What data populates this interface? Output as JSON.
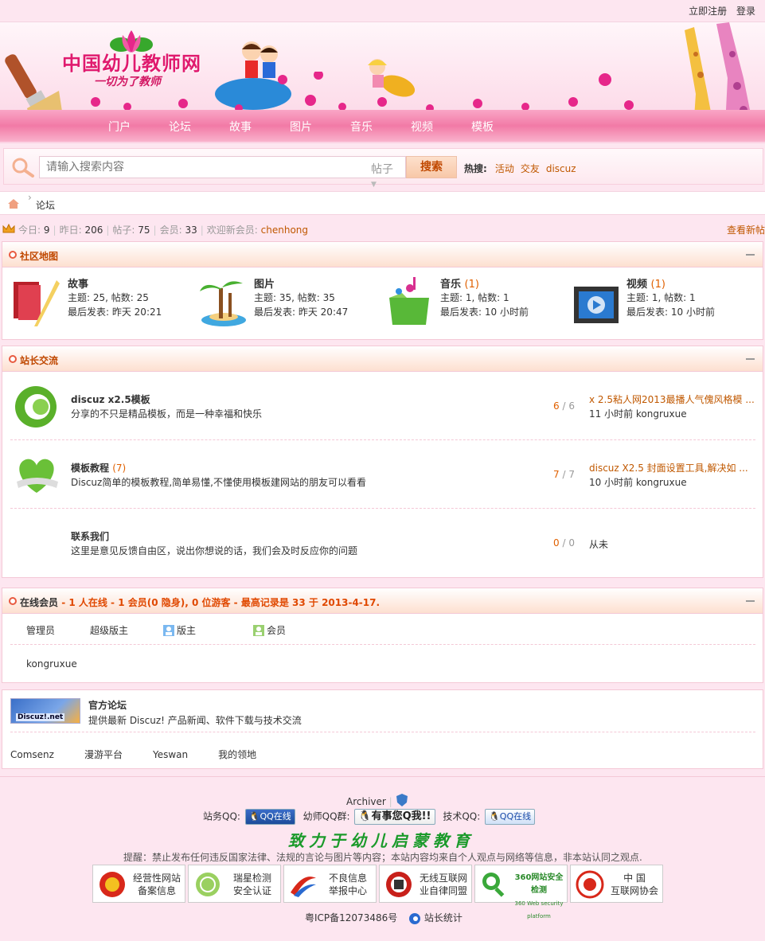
{
  "top": {
    "register": "立即注册",
    "login": "登录"
  },
  "brand": {
    "name": "中国幼儿教师网",
    "slogan": "一切为了教师"
  },
  "nav": [
    "门户",
    "论坛",
    "故事",
    "图片",
    "音乐",
    "视频",
    "模板"
  ],
  "search": {
    "placeholder": "请输入搜索内容",
    "type": "帖子",
    "button": "搜索",
    "hot_label": "热搜:",
    "hot": [
      "活动",
      "交友",
      "discuz"
    ]
  },
  "breadcrumb": {
    "current": "论坛"
  },
  "stats": {
    "today_label": "今日:",
    "today": "9",
    "yesterday_label": "昨日:",
    "yesterday": "206",
    "posts_label": "帖子:",
    "posts": "75",
    "members_label": "会员:",
    "members": "33",
    "welcome_label": "欢迎新会员:",
    "newest": "chenhong",
    "new_posts": "查看新帖"
  },
  "community": {
    "title": "社区地图",
    "cats": [
      {
        "name": "故事",
        "count": "",
        "l2": "主题: 25, 帖数: 25",
        "l3": "最后发表: 昨天 20:21",
        "icon": "book-quill-icon"
      },
      {
        "name": "图片",
        "count": "",
        "l2": "主题: 35, 帖数: 35",
        "l3": "最后发表: 昨天 20:47",
        "icon": "palm-island-icon"
      },
      {
        "name": "音乐",
        "count": "(1)",
        "l2": "主题: 1, 帖数: 1",
        "l3": "最后发表: 10 小时前",
        "icon": "music-folder-icon"
      },
      {
        "name": "视频",
        "count": "(1)",
        "l2": "主题: 1, 帖数: 1",
        "l3": "最后发表: 10 小时前",
        "icon": "film-strip-icon"
      }
    ]
  },
  "webmaster": {
    "title": "站长交流",
    "forums": [
      {
        "name": "discuz x2.5模板",
        "count": "",
        "desc": "分享的不只是精品模板，而是一种幸福和快乐",
        "threads": "6",
        "posts": "6",
        "last": "x 2.5粘人网2013最播人气傀风格模 ...",
        "meta": "11 小时前  kongruxue"
      },
      {
        "name": "模板教程",
        "count": "(7)",
        "desc": "Discuz简单的模板教程,简单易懂,不懂使用模板建网站的朋友可以看看",
        "threads": "7",
        "posts": "7",
        "last": "discuz X2.5 封面设置工具,解决如 ...",
        "meta": "10 小时前  kongruxue"
      },
      {
        "name": "联系我们",
        "count": "",
        "desc": "这里是意见反馈自由区，说出你想说的话，我们会及时反应你的问题",
        "threads": "0",
        "posts": "0",
        "never": "从未"
      }
    ]
  },
  "online": {
    "title": "在线会员",
    "summary": " - 1 人在线 - 1 会员(0 隐身), 0 位游客 - 最高记录是 33 于 2013-4-17.",
    "legend": [
      "管理员",
      "超级版主",
      "版主",
      "会员"
    ],
    "user": "kongruxue"
  },
  "links": {
    "logo_text": "Discuz!.net",
    "title": "官方论坛",
    "desc": "提供最新 Discuz! 产品新闻、软件下载与技术交流",
    "items": [
      "Comsenz",
      "漫游平台",
      "Yeswan",
      "我的领地"
    ]
  },
  "footer": {
    "archiver": "Archiver",
    "qq_site": "站务QQ:",
    "qq_btn": "QQ在线",
    "qq_group": "幼师QQ群:",
    "qq_msg": "有事您Q我!!",
    "qq_tech": "技术QQ:",
    "slogan": "致力于幼儿启蒙教育",
    "notice": "提醒：禁止发布任何违反国家法律、法规的言论与图片等内容；本站内容均来自个人观点与网络等信息，非本站认同之观点.",
    "badges": [
      {
        "l1": "经营性网站",
        "l2": "备案信息"
      },
      {
        "l1": "瑞星检测",
        "l2": "安全认证"
      },
      {
        "l1": "不良信息",
        "l2": "举报中心"
      },
      {
        "l1": "无线互联网",
        "l2": "业自律同盟"
      },
      {
        "l1": "360网站安全检测",
        "l2": "360 Web security platform"
      },
      {
        "l1": "中 国",
        "l2": "互联网协会"
      }
    ],
    "icp": "粤ICP备12073486号",
    "stats": "站长统计"
  },
  "colors": {
    "accent": "#c05800",
    "pink": "#f27aa6",
    "border": "#f4c8d6"
  }
}
